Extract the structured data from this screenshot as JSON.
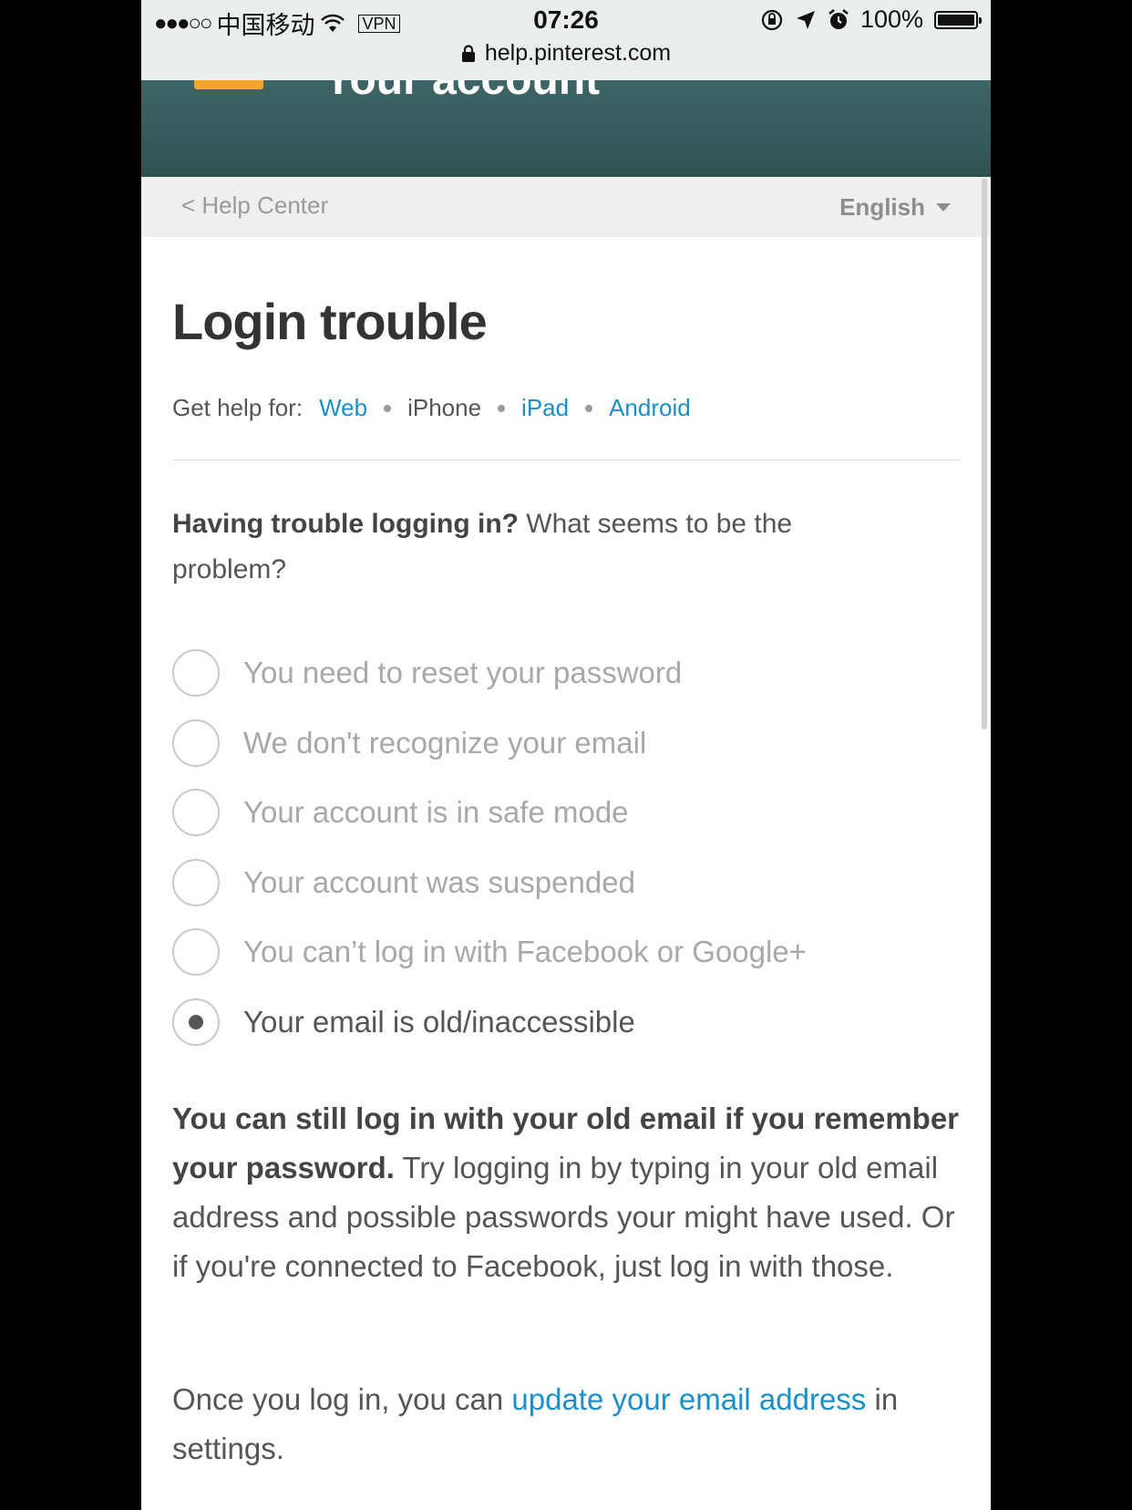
{
  "status_bar": {
    "signal": "●●●○○",
    "carrier": "中国移动",
    "vpn": "VPN",
    "time": "07:26",
    "battery": "100%"
  },
  "browser": {
    "url": "help.pinterest.com"
  },
  "banner": {
    "title": "Your account"
  },
  "nav": {
    "back_label": "< Help Center",
    "language": "English"
  },
  "page": {
    "title": "Login trouble",
    "help_for_label": "Get help for:",
    "platforms": [
      {
        "label": "Web",
        "active": false
      },
      {
        "label": "iPhone",
        "active": true
      },
      {
        "label": "iPad",
        "active": false
      },
      {
        "label": "Android",
        "active": false
      }
    ],
    "question_bold": "Having trouble logging in?",
    "question_rest": " What seems to be the problem?",
    "options": [
      {
        "label": "You need to reset your password",
        "selected": false
      },
      {
        "label": "We don't recognize your email",
        "selected": false
      },
      {
        "label": "Your account is in safe mode",
        "selected": false
      },
      {
        "label": "Your account was suspended",
        "selected": false
      },
      {
        "label": "You can’t log in with Facebook or Google+",
        "selected": false
      },
      {
        "label": "Your email is old/inaccessible",
        "selected": true
      }
    ],
    "answer_bold": "You can still log in with your old email if you remember your password.",
    "answer_rest": " Try logging in by typing in your old email address and possible passwords your might have used. Or if you're connected to Facebook, just log in with those.",
    "followup_before": "Once you log in, you can ",
    "followup_link": "update your email address",
    "followup_after": " in settings."
  }
}
